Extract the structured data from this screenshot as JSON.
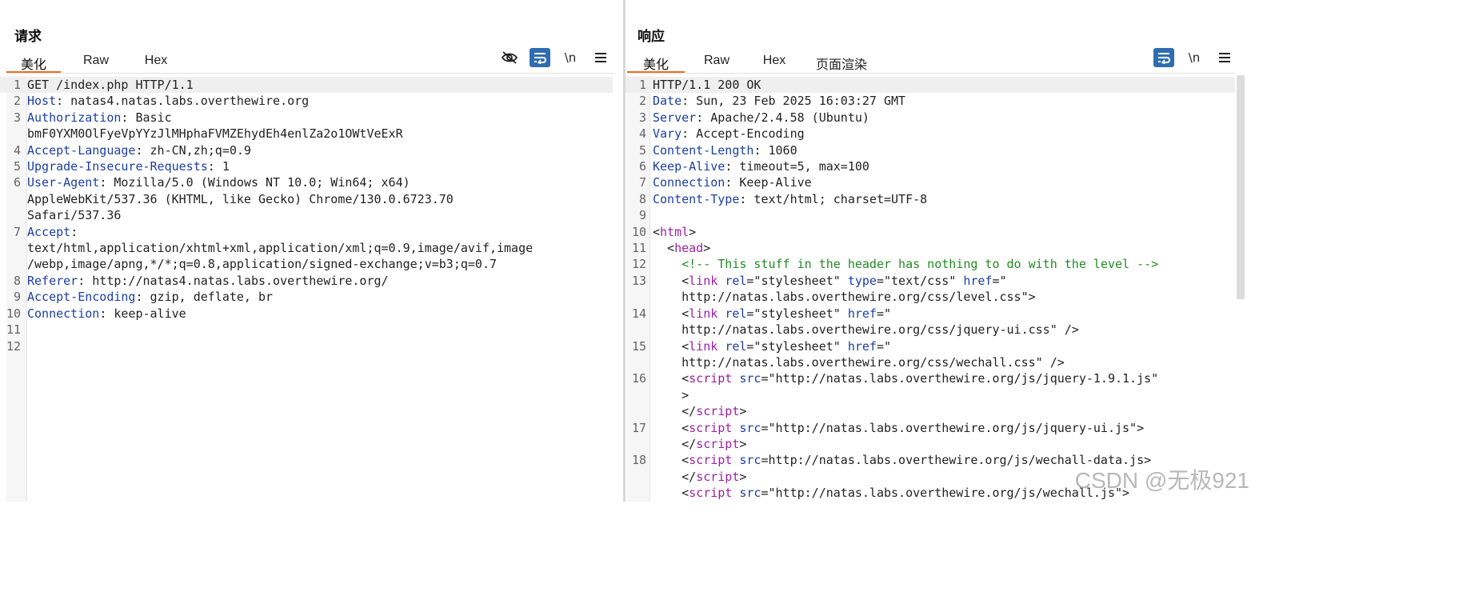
{
  "request": {
    "title": "请求",
    "tabs": [
      "美化",
      "Raw",
      "Hex"
    ],
    "tools": {
      "hide": "eye-off-icon",
      "wrap": "wrap-icon",
      "newline": "\\n",
      "menu": "menu-icon"
    },
    "lines": [
      {
        "n": "1",
        "hl": true,
        "segs": [
          [
            [
              "v",
              "GET /index.php HTTP/1.1"
            ]
          ]
        ]
      },
      {
        "n": "2",
        "segs": [
          [
            [
              "k",
              "Host"
            ],
            [
              "v",
              ": natas4.natas.labs.overthewire.org"
            ]
          ]
        ]
      },
      {
        "n": "3",
        "segs": [
          [
            [
              "k",
              "Authorization"
            ],
            [
              "v",
              ": Basic"
            ]
          ],
          [
            [
              "v",
              "bmF0YXM0OlFyeVpYYzJlMHphaFVMZEhydEh4enlZa2o1OWtVeExR"
            ]
          ]
        ]
      },
      {
        "n": "4",
        "segs": [
          [
            [
              "k",
              "Accept-Language"
            ],
            [
              "v",
              ": zh-CN,zh;q=0.9"
            ]
          ]
        ]
      },
      {
        "n": "5",
        "segs": [
          [
            [
              "k",
              "Upgrade-Insecure-Requests"
            ],
            [
              "v",
              ": 1"
            ]
          ]
        ]
      },
      {
        "n": "6",
        "segs": [
          [
            [
              "k",
              "User-Agent"
            ],
            [
              "v",
              ": Mozilla/5.0 (Windows NT 10.0; Win64; x64)"
            ]
          ],
          [
            [
              "v",
              "AppleWebKit/537.36 (KHTML, like Gecko) Chrome/130.0.6723.70"
            ]
          ],
          [
            [
              "v",
              "Safari/537.36"
            ]
          ]
        ]
      },
      {
        "n": "7",
        "segs": [
          [
            [
              "k",
              "Accept"
            ],
            [
              "v",
              ":"
            ]
          ],
          [
            [
              "v",
              "text/html,application/xhtml+xml,application/xml;q=0.9,image/avif,image"
            ]
          ],
          [
            [
              "v",
              "/webp,image/apng,*/*;q=0.8,application/signed-exchange;v=b3;q=0.7"
            ]
          ]
        ]
      },
      {
        "n": "8",
        "segs": [
          [
            [
              "k",
              "Referer"
            ],
            [
              "v",
              ": http://natas4.natas.labs.overthewire.org/"
            ]
          ]
        ]
      },
      {
        "n": "9",
        "segs": [
          [
            [
              "k",
              "Accept-Encoding"
            ],
            [
              "v",
              ": gzip, deflate, br"
            ]
          ]
        ]
      },
      {
        "n": "10",
        "segs": [
          [
            [
              "k",
              "Connection"
            ],
            [
              "v",
              ": keep-alive"
            ]
          ]
        ]
      },
      {
        "n": "11",
        "segs": [
          [
            [
              "v",
              ""
            ]
          ]
        ]
      },
      {
        "n": "12",
        "segs": [
          [
            [
              "v",
              ""
            ]
          ]
        ]
      }
    ]
  },
  "response": {
    "title": "响应",
    "tabs": [
      "美化",
      "Raw",
      "Hex",
      "页面渲染"
    ],
    "tools": {
      "wrap": "wrap-icon",
      "newline": "\\n",
      "menu": "menu-icon"
    },
    "lines": [
      {
        "n": "1",
        "hl": true,
        "segs": [
          [
            [
              "v",
              "HTTP/1.1 200 OK"
            ]
          ]
        ]
      },
      {
        "n": "2",
        "segs": [
          [
            [
              "k",
              "Date"
            ],
            [
              "v",
              ": Sun, 23 Feb 2025 16:03:27 GMT"
            ]
          ]
        ]
      },
      {
        "n": "3",
        "segs": [
          [
            [
              "k",
              "Server"
            ],
            [
              "v",
              ": Apache/2.4.58 (Ubuntu)"
            ]
          ]
        ]
      },
      {
        "n": "4",
        "segs": [
          [
            [
              "k",
              "Vary"
            ],
            [
              "v",
              ": Accept-Encoding"
            ]
          ]
        ]
      },
      {
        "n": "5",
        "segs": [
          [
            [
              "k",
              "Content-Length"
            ],
            [
              "v",
              ": 1060"
            ]
          ]
        ]
      },
      {
        "n": "6",
        "segs": [
          [
            [
              "k",
              "Keep-Alive"
            ],
            [
              "v",
              ": timeout=5, max=100"
            ]
          ]
        ]
      },
      {
        "n": "7",
        "segs": [
          [
            [
              "k",
              "Connection"
            ],
            [
              "v",
              ": Keep-Alive"
            ]
          ]
        ]
      },
      {
        "n": "8",
        "segs": [
          [
            [
              "k",
              "Content-Type"
            ],
            [
              "v",
              ": text/html; charset=UTF-8"
            ]
          ]
        ]
      },
      {
        "n": "9",
        "segs": [
          [
            [
              "v",
              ""
            ]
          ]
        ]
      },
      {
        "n": "10",
        "segs": [
          [
            [
              "v",
              "<"
            ],
            [
              "tag",
              "html"
            ],
            [
              "v",
              ">"
            ]
          ]
        ]
      },
      {
        "n": "11",
        "segs": [
          [
            [
              "v",
              "  <"
            ],
            [
              "tag",
              "head"
            ],
            [
              "v",
              ">"
            ]
          ]
        ]
      },
      {
        "n": "12",
        "segs": [
          [
            [
              "cmt",
              "    <!-- This stuff in the header has nothing to do with the level -->"
            ]
          ]
        ]
      },
      {
        "n": "13",
        "segs": [
          [
            [
              "v",
              "    <"
            ],
            [
              "tag",
              "link"
            ],
            [
              "v",
              " "
            ],
            [
              "attr",
              "rel"
            ],
            [
              "v",
              "=\"stylesheet\" "
            ],
            [
              "attr",
              "type"
            ],
            [
              "v",
              "=\"text/css\" "
            ],
            [
              "attr",
              "href"
            ],
            [
              "v",
              "=\""
            ]
          ],
          [
            [
              "v",
              "    http://natas.labs.overthewire.org/css/level.css\">"
            ]
          ]
        ]
      },
      {
        "n": "14",
        "segs": [
          [
            [
              "v",
              "    <"
            ],
            [
              "tag",
              "link"
            ],
            [
              "v",
              " "
            ],
            [
              "attr",
              "rel"
            ],
            [
              "v",
              "=\"stylesheet\" "
            ],
            [
              "attr",
              "href"
            ],
            [
              "v",
              "=\""
            ]
          ],
          [
            [
              "v",
              "    http://natas.labs.overthewire.org/css/jquery-ui.css\" />"
            ]
          ]
        ]
      },
      {
        "n": "15",
        "segs": [
          [
            [
              "v",
              "    <"
            ],
            [
              "tag",
              "link"
            ],
            [
              "v",
              " "
            ],
            [
              "attr",
              "rel"
            ],
            [
              "v",
              "=\"stylesheet\" "
            ],
            [
              "attr",
              "href"
            ],
            [
              "v",
              "=\""
            ]
          ],
          [
            [
              "v",
              "    http://natas.labs.overthewire.org/css/wechall.css\" />"
            ]
          ]
        ]
      },
      {
        "n": "16",
        "segs": [
          [
            [
              "v",
              "    <"
            ],
            [
              "tag",
              "script"
            ],
            [
              "v",
              " "
            ],
            [
              "attr",
              "src"
            ],
            [
              "v",
              "=\"http://natas.labs.overthewire.org/js/jquery-1.9.1.js\""
            ]
          ],
          [
            [
              "v",
              "    >"
            ]
          ],
          [
            [
              "v",
              "    </"
            ],
            [
              "tag",
              "script"
            ],
            [
              "v",
              ">"
            ]
          ]
        ]
      },
      {
        "n": "17",
        "segs": [
          [
            [
              "v",
              "    <"
            ],
            [
              "tag",
              "script"
            ],
            [
              "v",
              " "
            ],
            [
              "attr",
              "src"
            ],
            [
              "v",
              "=\"http://natas.labs.overthewire.org/js/jquery-ui.js\">"
            ]
          ],
          [
            [
              "v",
              "    </"
            ],
            [
              "tag",
              "script"
            ],
            [
              "v",
              ">"
            ]
          ]
        ]
      },
      {
        "n": "18",
        "segs": [
          [
            [
              "v",
              "    <"
            ],
            [
              "tag",
              "script"
            ],
            [
              "v",
              " "
            ],
            [
              "attr",
              "src"
            ],
            [
              "v",
              "=http://natas.labs.overthewire.org/js/wechall-data.js>"
            ]
          ],
          [
            [
              "v",
              "    </"
            ],
            [
              "tag",
              "script"
            ],
            [
              "v",
              ">"
            ]
          ],
          [
            [
              "v",
              "    <"
            ],
            [
              "tag",
              "script"
            ],
            [
              "v",
              " "
            ],
            [
              "attr",
              "src"
            ],
            [
              "v",
              "=\"http://natas.labs.overthewire.org/js/wechall.js\">"
            ]
          ]
        ]
      }
    ]
  },
  "watermark": "CSDN @无极921"
}
